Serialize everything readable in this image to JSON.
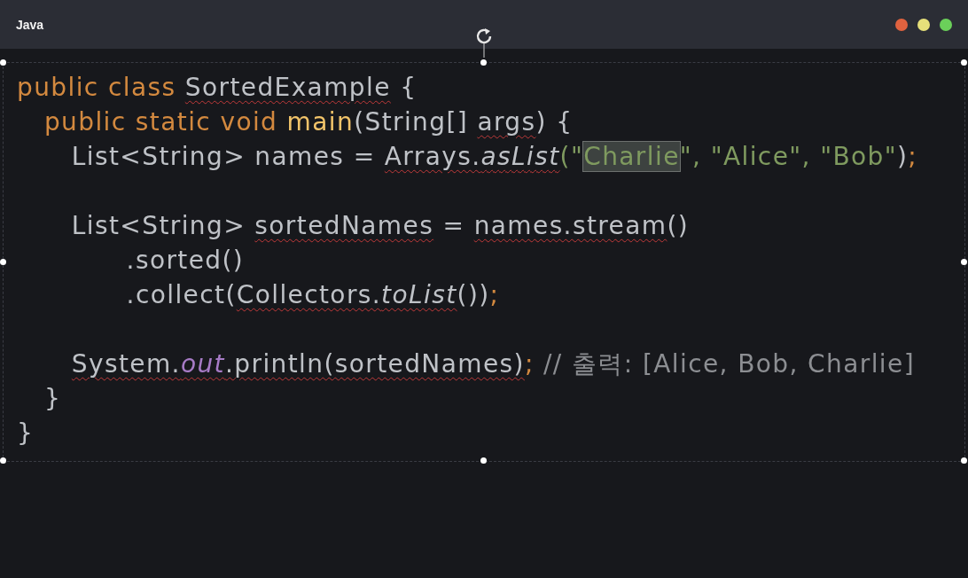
{
  "window": {
    "title": "Java"
  },
  "code": {
    "lines": [
      {
        "tokens": [
          {
            "text": "public class ",
            "kind": "keyword"
          },
          {
            "text": "SortedExample",
            "kind": "plain",
            "error": true
          },
          {
            "text": " {",
            "kind": "plain"
          }
        ]
      },
      {
        "tokens": [
          {
            "text": "   public static void ",
            "kind": "keyword"
          },
          {
            "text": "main",
            "kind": "method"
          },
          {
            "text": "(String[] ",
            "kind": "plain"
          },
          {
            "text": "args",
            "kind": "plain",
            "error": true
          },
          {
            "text": ") {",
            "kind": "plain"
          }
        ]
      },
      {
        "tokens": [
          {
            "text": "      List<String> names = ",
            "kind": "plain"
          },
          {
            "text": "Arrays.",
            "kind": "plain",
            "error": true
          },
          {
            "text": "asList",
            "kind": "static-method",
            "error": true
          },
          {
            "text": "(\"",
            "kind": "string"
          },
          {
            "text": "Charlie",
            "kind": "string",
            "highlighted": true
          },
          {
            "text": "\", \"Alice\", \"Bob\"",
            "kind": "string"
          },
          {
            "text": ")",
            "kind": "plain"
          },
          {
            "text": ";",
            "kind": "keyword"
          }
        ]
      },
      {
        "gap_before": true,
        "tokens": [
          {
            "text": "      List<String> ",
            "kind": "plain"
          },
          {
            "text": "sortedNames",
            "kind": "plain",
            "error": true
          },
          {
            "text": " = ",
            "kind": "plain"
          },
          {
            "text": "names.stream",
            "kind": "plain",
            "error": true
          },
          {
            "text": "()",
            "kind": "plain"
          }
        ]
      },
      {
        "tokens": [
          {
            "text": "            .sorted()",
            "kind": "plain"
          }
        ]
      },
      {
        "tokens": [
          {
            "text": "            .collect(",
            "kind": "plain"
          },
          {
            "text": "Collectors.",
            "kind": "plain",
            "error": true
          },
          {
            "text": "toList",
            "kind": "static-method",
            "error": true
          },
          {
            "text": "())",
            "kind": "plain"
          },
          {
            "text": ";",
            "kind": "keyword"
          }
        ]
      },
      {
        "gap_before": true,
        "tokens": [
          {
            "text": "      System.",
            "kind": "plain",
            "error": true
          },
          {
            "text": "out",
            "kind": "static-field",
            "error": true
          },
          {
            "text": ".println(sortedNames)",
            "kind": "plain",
            "error": true
          },
          {
            "text": ";",
            "kind": "keyword"
          },
          {
            "text": " // 출력: [Alice, Bob, Charlie]",
            "kind": "comment"
          }
        ]
      },
      {
        "tokens": [
          {
            "text": "   }",
            "kind": "plain"
          }
        ]
      },
      {
        "tokens": [
          {
            "text": "}",
            "kind": "plain"
          }
        ]
      }
    ]
  }
}
